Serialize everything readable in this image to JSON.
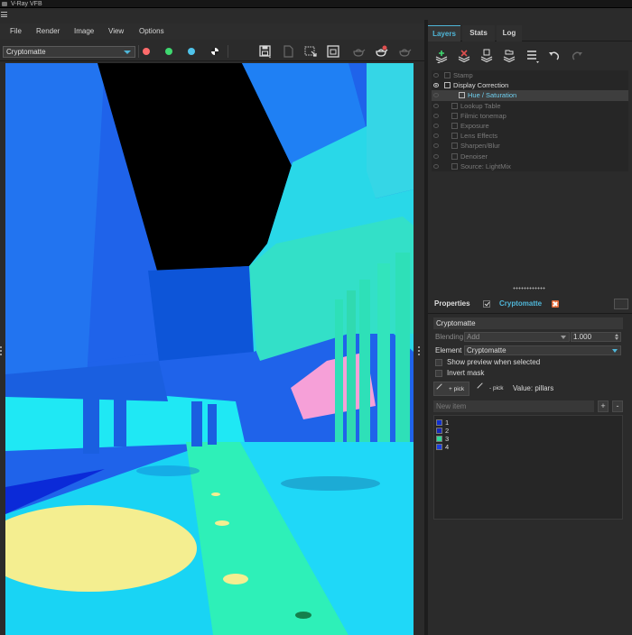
{
  "window": {
    "title": "V-Ray VFB"
  },
  "menu": {
    "items": [
      "File",
      "Render",
      "Image",
      "View",
      "Options"
    ]
  },
  "toolbar": {
    "channel": "Cryptomatte",
    "channel_dots": [
      "#ff6b6b",
      "#3fd870",
      "#4fc3ea",
      "#dcdcdc"
    ]
  },
  "tabs": [
    "Layers",
    "Stats",
    "Log"
  ],
  "layers": [
    {
      "label": "Stamp",
      "indent": 0,
      "visible": false,
      "enabled": false,
      "selected": false
    },
    {
      "label": "Display Correction",
      "indent": 0,
      "visible": true,
      "enabled": true,
      "selected": false
    },
    {
      "label": "Hue / Saturation",
      "indent": 2,
      "visible": false,
      "enabled": true,
      "selected": true
    },
    {
      "label": "Lookup Table",
      "indent": 1,
      "visible": false,
      "enabled": false,
      "selected": false
    },
    {
      "label": "Filmic tonemap",
      "indent": 1,
      "visible": false,
      "enabled": false,
      "selected": false
    },
    {
      "label": "Exposure",
      "indent": 1,
      "visible": false,
      "enabled": false,
      "selected": false
    },
    {
      "label": "Lens Effects",
      "indent": 1,
      "visible": false,
      "enabled": false,
      "selected": false
    },
    {
      "label": "Sharpen/Blur",
      "indent": 1,
      "visible": false,
      "enabled": false,
      "selected": false
    },
    {
      "label": "Denoiser",
      "indent": 1,
      "visible": false,
      "enabled": false,
      "selected": false
    },
    {
      "label": "Source: LightMix",
      "indent": 1,
      "visible": false,
      "enabled": false,
      "selected": false
    }
  ],
  "properties": {
    "title": "Properties",
    "layer_name": "Cryptomatte",
    "name_value": "Cryptomatte",
    "blending_label": "Blending",
    "blending_value": "Add",
    "opacity_value": "1.000",
    "element_label": "Element",
    "element_value": "Cryptomatte",
    "show_preview_label": "Show preview when selected",
    "invert_mask_label": "Invert mask",
    "pick_add_label": "+ pick",
    "pick_remove_label": "- pick",
    "value_text": "Value: pillars",
    "new_item_placeholder": "New item",
    "add_btn": "+",
    "remove_btn": "-",
    "items": [
      {
        "num": "1",
        "color": "#1030d0"
      },
      {
        "num": "2",
        "color": "#1828b8"
      },
      {
        "num": "3",
        "color": "#30d898"
      },
      {
        "num": "4",
        "color": "#1c40e0"
      }
    ]
  },
  "colors": {
    "accent": "#4fb6d8",
    "panel": "#2b2b2b",
    "close": "#e06a3a"
  },
  "icons": [
    "hamburger-menu-icon",
    "save-icon",
    "clone-icon",
    "region-render-icon",
    "compare-icon",
    "teapot-icon",
    "teapot-render-icon",
    "teapot-stop-icon",
    "add-layer-icon",
    "delete-layer-icon",
    "save-layers-icon",
    "load-layers-icon",
    "layer-list-icon",
    "undo-icon",
    "redo-icon"
  ]
}
